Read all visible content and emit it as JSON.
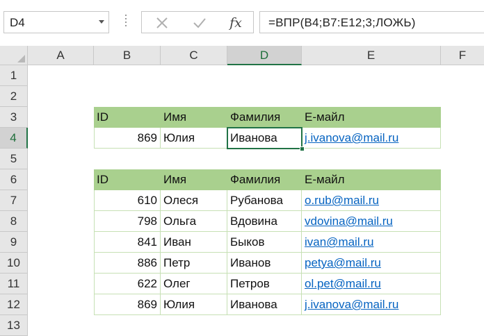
{
  "name_box": "D4",
  "formula": "=ВПР(B4;B7:E12;3;ЛОЖЬ)",
  "fx_label": "fx",
  "columns": [
    "A",
    "B",
    "C",
    "D",
    "E",
    "F"
  ],
  "rows": [
    "1",
    "2",
    "3",
    "4",
    "5",
    "6",
    "7",
    "8",
    "9",
    "10",
    "11",
    "12",
    "13"
  ],
  "selected_cell": "D4",
  "lookup_table": {
    "headers": [
      "ID",
      "Имя",
      "Фамилия",
      "E-майл"
    ],
    "row": {
      "id": "869",
      "name": "Юлия",
      "surname": "Иванова",
      "email": "j.ivanova@mail.ru"
    }
  },
  "data_table": {
    "headers": [
      "ID",
      "Имя",
      "Фамилия",
      "E-майл"
    ],
    "rows": [
      {
        "id": "610",
        "name": "Олеся",
        "surname": "Рубанова",
        "email": "o.rub@mail.ru"
      },
      {
        "id": "798",
        "name": "Ольга",
        "surname": "Вдовина",
        "email": "vdovina@mail.ru"
      },
      {
        "id": "841",
        "name": "Иван",
        "surname": "Быков",
        "email": "ivan@mail.ru"
      },
      {
        "id": "886",
        "name": "Петр",
        "surname": "Иванов",
        "email": "petya@mail.ru"
      },
      {
        "id": "622",
        "name": "Олег",
        "surname": "Петров",
        "email": "ol.pet@mail.ru"
      },
      {
        "id": "869",
        "name": "Юлия",
        "surname": "Иванова",
        "email": "j.ivanova@mail.ru"
      }
    ]
  },
  "colors": {
    "header_fill": "#a9d08e",
    "accent": "#217346",
    "link": "#0563c1"
  }
}
